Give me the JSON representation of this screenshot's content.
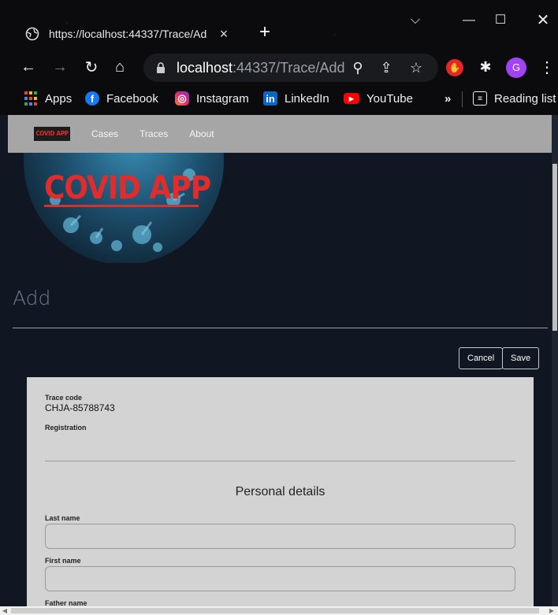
{
  "browser": {
    "tab_title": "https://localhost:44337/Trace/Ad",
    "tab_close": "×",
    "new_tab": "+",
    "url_host": "localhost",
    "url_path": ":44337/Trace/Add",
    "avatar_letter": "G",
    "bookmarks": [
      {
        "label": "Apps",
        "icon": "apps-grid-icon",
        "color": "#e53935"
      },
      {
        "label": "Facebook",
        "icon": "facebook-icon",
        "color": "#1877f2"
      },
      {
        "label": "Instagram",
        "icon": "instagram-icon",
        "color": "#d6249f"
      },
      {
        "label": "LinkedIn",
        "icon": "linkedin-icon",
        "color": "#0a66c2"
      },
      {
        "label": "YouTube",
        "icon": "youtube-icon",
        "color": "#ff0000"
      }
    ],
    "bookmarks_more": "»",
    "reading_list": "Reading list"
  },
  "navbar": {
    "logo_text": "COVID APP",
    "links": [
      "Cases",
      "Traces",
      "About"
    ]
  },
  "banner": {
    "logo_text": "COVID APP"
  },
  "page": {
    "title": "Add",
    "cancel_label": "Cancel",
    "save_label": "Save"
  },
  "form": {
    "trace_code_label": "Trace code",
    "trace_code_value": "CHJA-85788743",
    "registration_label": "Registration",
    "section_title": "Personal details",
    "last_name_label": "Last name",
    "last_name_value": "",
    "first_name_label": "First name",
    "first_name_value": "",
    "father_name_label": "Father name"
  },
  "colors": {
    "page_bg": "#111722",
    "navbar_bg": "#a6a6a6",
    "card_bg": "#d3d3d3",
    "logo_red": "#e22b2b"
  }
}
